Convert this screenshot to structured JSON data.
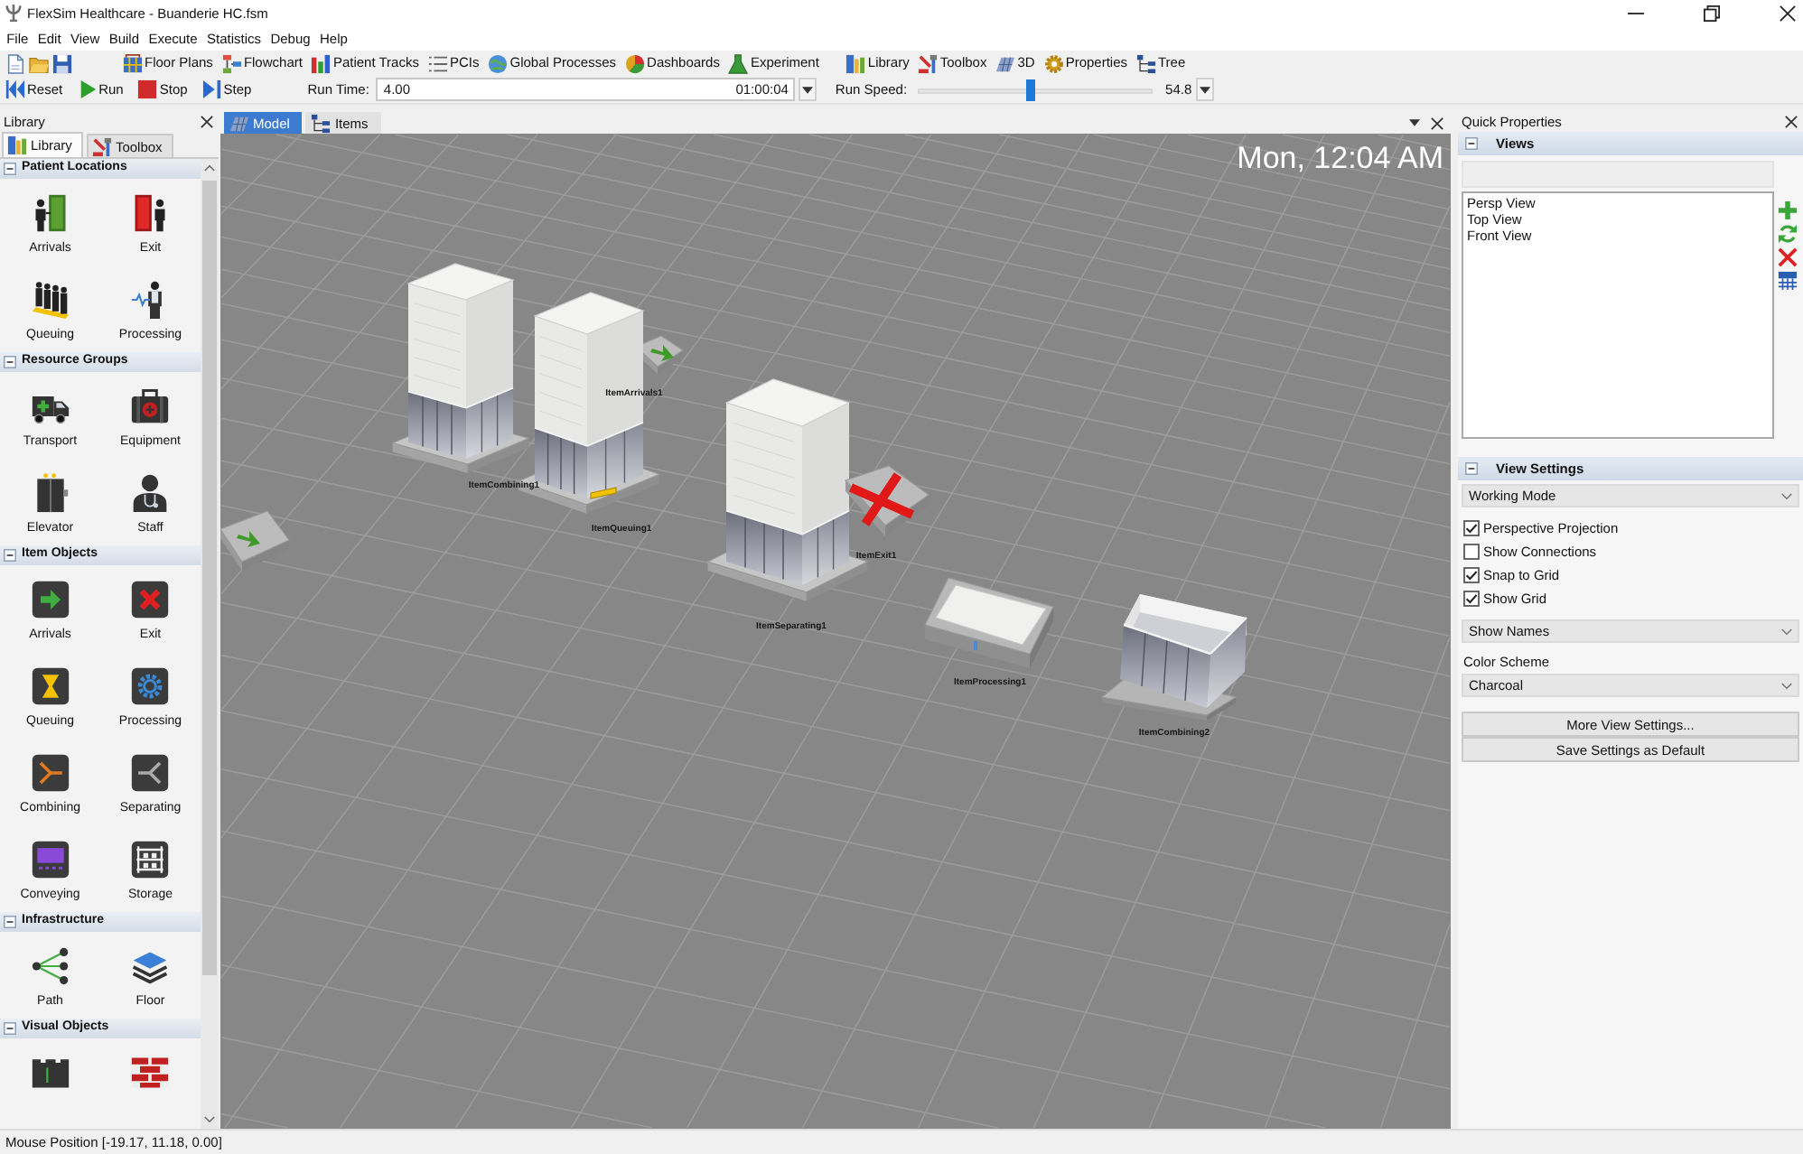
{
  "window": {
    "title": "FlexSim Healthcare - Buanderie HC.fsm"
  },
  "menu": [
    "File",
    "Edit",
    "View",
    "Build",
    "Execute",
    "Statistics",
    "Debug",
    "Help"
  ],
  "toolbar": [
    "Floor Plans",
    "Flowchart",
    "Patient Tracks",
    "PCIs",
    "Global Processes",
    "Dashboards",
    "Experiment",
    "Library",
    "Toolbox",
    "3D",
    "Properties",
    "Tree"
  ],
  "run_controls": {
    "buttons": [
      "Reset",
      "Run",
      "Stop",
      "Step"
    ],
    "run_time_label": "Run Time:",
    "run_time": "4.00",
    "clock": "01:00:04",
    "run_speed_label": "Run Speed:",
    "run_speed": {
      "level": 0.48
    },
    "run_speed_value": "54.8"
  },
  "library_panel": {
    "title": "Library",
    "tabs": [
      {
        "label": "Library",
        "selected": true
      },
      {
        "label": "Toolbox",
        "selected": false
      }
    ],
    "sections": [
      {
        "title": "Patient Locations",
        "expanded": true,
        "items": [
          "Arrivals",
          "Exit",
          "Queuing",
          "Processing"
        ]
      },
      {
        "title": "Resource Groups",
        "expanded": true,
        "items": [
          "Transport",
          "Equipment",
          "Elevator",
          "Staff"
        ]
      },
      {
        "title": "Item Objects",
        "expanded": true,
        "items": [
          "Arrivals",
          "Exit",
          "Queuing",
          "Processing",
          "Combining",
          "Separating",
          "Conveying",
          "Storage"
        ]
      },
      {
        "title": "Infrastructure",
        "expanded": true,
        "items": [
          "Path",
          "Floor"
        ]
      },
      {
        "title": "Visual Objects",
        "expanded": true
      }
    ]
  },
  "model_view": {
    "tabs": [
      {
        "label": "Model",
        "selected": true
      },
      {
        "label": "Items",
        "selected": false
      }
    ],
    "clock": "Mon, 12:04 AM",
    "objects": [
      {
        "kind": "arrivals"
      },
      {
        "kind": "arrivals",
        "label": "ItemArrivals1"
      },
      {
        "kind": "tower",
        "label": "ItemCombining1"
      },
      {
        "kind": "queue",
        "label": "ItemQueuing1"
      },
      {
        "kind": "tower",
        "label": "ItemSeparating1"
      },
      {
        "kind": "exit",
        "label": "ItemExit1"
      },
      {
        "kind": "processor",
        "label": "ItemProcessing1"
      },
      {
        "kind": "open_box",
        "label": "ItemCombining2"
      }
    ]
  },
  "quick_properties": {
    "title": "Quick Properties",
    "views": {
      "title": "Views",
      "expanded": true,
      "items": [
        {
          "label": "Persp View",
          "selected": false
        },
        {
          "label": "Top View",
          "selected": false
        },
        {
          "label": "Front View",
          "selected": false
        }
      ]
    },
    "view_settings": {
      "title": "View Settings",
      "expanded": true,
      "controls": [
        {
          "kind": "dropdown",
          "value": "Working Mode"
        },
        {
          "kind": "checkbox",
          "label": "Perspective Projection",
          "checked": true
        },
        {
          "kind": "checkbox",
          "label": "Show Connections",
          "checked": false
        },
        {
          "kind": "checkbox",
          "label": "Snap to Grid",
          "checked": true
        },
        {
          "kind": "checkbox",
          "label": "Show Grid",
          "checked": true
        },
        {
          "kind": "dropdown",
          "value": "Show Names"
        },
        {
          "kind": "label",
          "text": "Color Scheme"
        },
        {
          "kind": "dropdown",
          "value": "Charcoal"
        },
        {
          "kind": "button",
          "label": "More View Settings..."
        },
        {
          "kind": "button",
          "label": "Save Settings as Default"
        }
      ]
    }
  },
  "status_bar": {
    "text": "Mouse Position [-19.17, 11.18, 0.00]"
  }
}
